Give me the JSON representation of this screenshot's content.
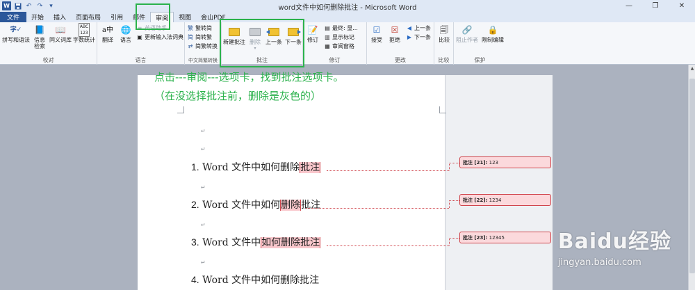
{
  "window": {
    "title": "word文件中如何删除批注 - Microsoft Word",
    "minimize_icon": "minimize-icon",
    "restore_icon": "restore-icon",
    "close_icon": "close-icon"
  },
  "tabs": [
    {
      "label": "文件"
    },
    {
      "label": "开始"
    },
    {
      "label": "插入"
    },
    {
      "label": "页面布局"
    },
    {
      "label": "引用"
    },
    {
      "label": "邮件"
    },
    {
      "label": "审阅"
    },
    {
      "label": "视图"
    },
    {
      "label": "金山PDF"
    }
  ],
  "ribbon": {
    "proofing": {
      "label": "校对",
      "spell": "拼写和语法",
      "research": "信息\n检索",
      "thesaurus": "同义词库",
      "wordcount": "字数统计"
    },
    "language": {
      "label": "语言",
      "translate": "翻译",
      "language": "语言",
      "english_assist": "英语助手",
      "update_ime": "更新输入法词典"
    },
    "chinese": {
      "label": "中文简繁转换",
      "trad_to_simp": "繁转简",
      "simp_to_trad": "简转繁",
      "convert": "简繁转换"
    },
    "comments": {
      "label": "批注",
      "new": "新建批注",
      "delete": "删除",
      "prev": "上一条",
      "next": "下一条"
    },
    "tracking": {
      "label": "修订",
      "track": "修订",
      "final_show": "最终: 显...",
      "show_markup": "显示标记",
      "review_pane": "审阅窗格"
    },
    "changes": {
      "label": "更改",
      "accept": "接受",
      "reject": "拒绝",
      "prev": "上一条",
      "next": "下一条"
    },
    "compare": {
      "label": "比较",
      "compare": "比较"
    },
    "protect": {
      "label": "保护",
      "block": "阻止作者",
      "restrict": "限制编辑"
    }
  },
  "annotation": {
    "line1": "点击---审阅---选项卡，找到批注选项卡。",
    "line2": "（在没选择批注前，删除是灰色的）"
  },
  "document": {
    "lines": [
      {
        "num": "1.",
        "pre": "Word 文件中如何删除",
        "hl": "批注",
        "post": ""
      },
      {
        "num": "2.",
        "pre": "Word 文件中如何",
        "hl": "删除",
        "post": "批注"
      },
      {
        "num": "3.",
        "pre": "Word 文件中",
        "hl": "如何删除批注",
        "post": ""
      },
      {
        "num": "4.",
        "pre": "Word 文件中如何删除批注",
        "hl": "",
        "post": ""
      }
    ],
    "para_mark": "↵"
  },
  "comments": [
    {
      "label": "批注 [21]:",
      "text": "123"
    },
    {
      "label": "批注 [22]:",
      "text": "1234"
    },
    {
      "label": "批注 [23]:",
      "text": "12345"
    }
  ],
  "watermark": {
    "brand": "Baidu经验",
    "url": "jingyan.baidu.com"
  }
}
